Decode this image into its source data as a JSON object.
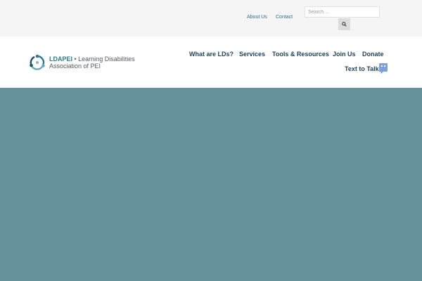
{
  "top_bar": {
    "links": [
      "About Us",
      "Contact"
    ],
    "search": {
      "placeholder": "Search ...",
      "value": ""
    }
  },
  "logo": {
    "abbreviation": "LDAPEI",
    "line1_rest": " • Learning Disabilities",
    "line2": "Association of PEI"
  },
  "nav": {
    "items": [
      "What are LDs?",
      "Services",
      "Tools & Resources",
      "Join Us",
      "Donate"
    ],
    "text_to_talk": "Text to Talk"
  },
  "colors": {
    "top_bar_bg": "#f5f5f5",
    "link": "#2e6f86",
    "nav_text": "#1f3f57",
    "hero_bg": "#64939e",
    "chat_icon": "#7fa0d8"
  },
  "icons": {
    "search": "search-icon",
    "logo": "ldapei-logo-mark",
    "chat": "chat-bubble-icon"
  }
}
